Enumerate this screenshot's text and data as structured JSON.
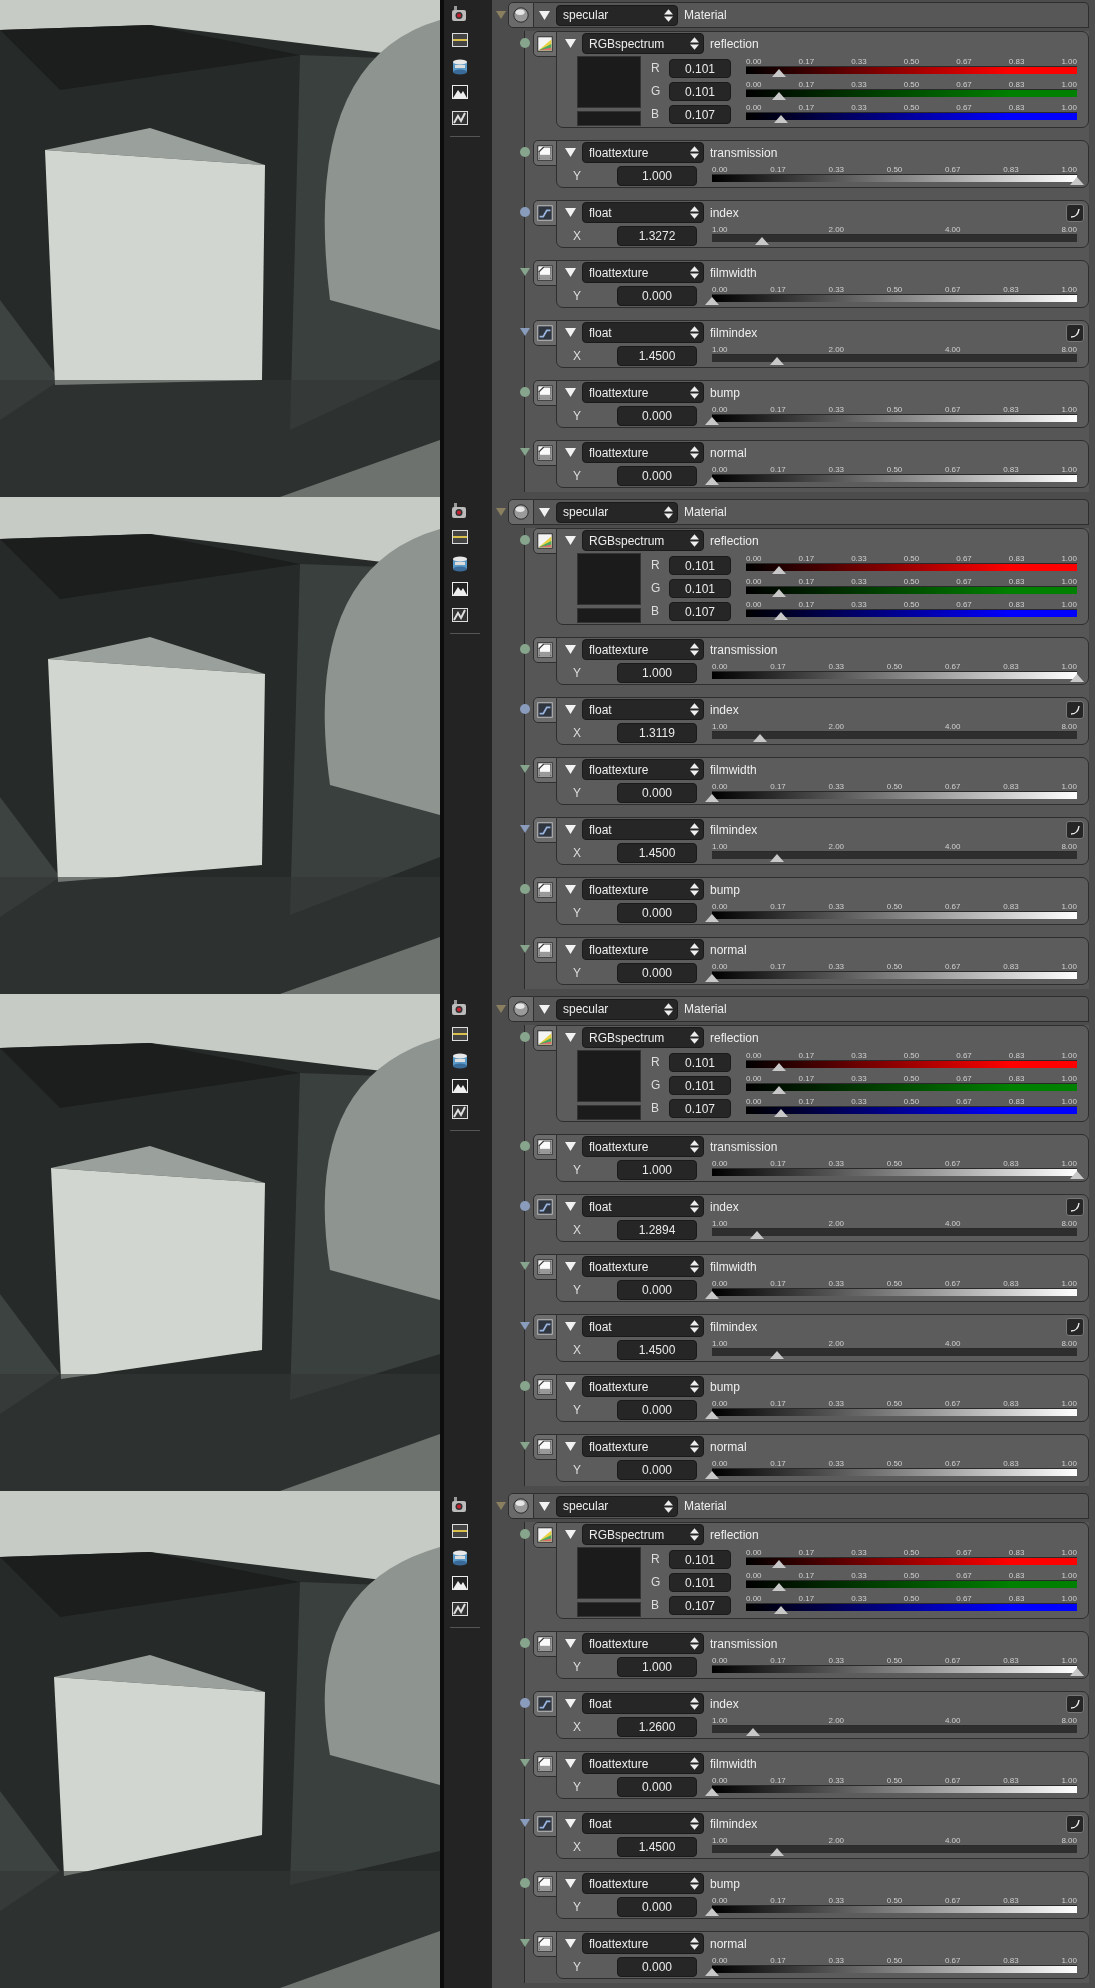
{
  "panels": [
    {
      "material": {
        "arrow_connector": true,
        "type": "specular",
        "label": "Material"
      },
      "params": [
        {
          "kind": "rgb",
          "arrow_connector": false,
          "type": "RGBspectrum",
          "name": "reflection",
          "channels": [
            {
              "axis": "R",
              "value": "0.101",
              "level": 0.101,
              "color": "#ff0000",
              "ticks": [
                "0.00",
                "0.17",
                "0.33",
                "0.50",
                "0.67",
                "0.83",
                "1.00"
              ]
            },
            {
              "axis": "G",
              "value": "0.101",
              "level": 0.101,
              "color": "#008000",
              "ticks": [
                "0.00",
                "0.17",
                "0.33",
                "0.50",
                "0.67",
                "0.83",
                "1.00"
              ]
            },
            {
              "axis": "B",
              "value": "0.107",
              "level": 0.107,
              "color": "#0000ff",
              "ticks": [
                "0.00",
                "0.17",
                "0.33",
                "0.50",
                "0.67",
                "0.83",
                "1.00"
              ]
            }
          ]
        },
        {
          "kind": "texture",
          "arrow_connector": false,
          "type": "floattexture",
          "name": "transmission",
          "axis": "Y",
          "value": "1.000",
          "level": 1,
          "ticks": [
            "0.00",
            "0.17",
            "0.33",
            "0.50",
            "0.67",
            "0.83",
            "1.00"
          ]
        },
        {
          "kind": "float",
          "arrow_connector": false,
          "type": "float",
          "name": "index",
          "axis": "X",
          "value": "1.3272",
          "level": 0.136,
          "ticks": [
            "1.00",
            "2.00",
            "4.00",
            "8.00"
          ]
        },
        {
          "kind": "texture",
          "arrow_connector": true,
          "type": "floattexture",
          "name": "filmwidth",
          "axis": "Y",
          "value": "0.000",
          "level": 0,
          "ticks": [
            "0.00",
            "0.17",
            "0.33",
            "0.50",
            "0.67",
            "0.83",
            "1.00"
          ]
        },
        {
          "kind": "float",
          "arrow_connector": true,
          "type": "float",
          "name": "filmindex",
          "axis": "X",
          "value": "1.4500",
          "level": 0.179,
          "ticks": [
            "1.00",
            "2.00",
            "4.00",
            "8.00"
          ]
        },
        {
          "kind": "texture",
          "arrow_connector": false,
          "type": "floattexture",
          "name": "bump",
          "axis": "Y",
          "value": "0.000",
          "level": 0,
          "ticks": [
            "0.00",
            "0.17",
            "0.33",
            "0.50",
            "0.67",
            "0.83",
            "1.00"
          ]
        },
        {
          "kind": "texture",
          "arrow_connector": true,
          "type": "floattexture",
          "name": "normal",
          "axis": "Y",
          "value": "0.000",
          "level": 0,
          "ticks": [
            "0.00",
            "0.17",
            "0.33",
            "0.50",
            "0.67",
            "0.83",
            "1.00"
          ]
        }
      ]
    },
    {
      "material": {
        "arrow_connector": true,
        "type": "specular",
        "label": "Material"
      },
      "params": [
        {
          "kind": "rgb",
          "arrow_connector": false,
          "type": "RGBspectrum",
          "name": "reflection",
          "channels": [
            {
              "axis": "R",
              "value": "0.101",
              "level": 0.101,
              "color": "#ff0000",
              "ticks": [
                "0.00",
                "0.17",
                "0.33",
                "0.50",
                "0.67",
                "0.83",
                "1.00"
              ]
            },
            {
              "axis": "G",
              "value": "0.101",
              "level": 0.101,
              "color": "#008000",
              "ticks": [
                "0.00",
                "0.17",
                "0.33",
                "0.50",
                "0.67",
                "0.83",
                "1.00"
              ]
            },
            {
              "axis": "B",
              "value": "0.107",
              "level": 0.107,
              "color": "#0000ff",
              "ticks": [
                "0.00",
                "0.17",
                "0.33",
                "0.50",
                "0.67",
                "0.83",
                "1.00"
              ]
            }
          ]
        },
        {
          "kind": "texture",
          "arrow_connector": false,
          "type": "floattexture",
          "name": "transmission",
          "axis": "Y",
          "value": "1.000",
          "level": 1,
          "ticks": [
            "0.00",
            "0.17",
            "0.33",
            "0.50",
            "0.67",
            "0.83",
            "1.00"
          ]
        },
        {
          "kind": "float",
          "arrow_connector": false,
          "type": "float",
          "name": "index",
          "axis": "X",
          "value": "1.3119",
          "level": 0.131,
          "ticks": [
            "1.00",
            "2.00",
            "4.00",
            "8.00"
          ]
        },
        {
          "kind": "texture",
          "arrow_connector": true,
          "type": "floattexture",
          "name": "filmwidth",
          "axis": "Y",
          "value": "0.000",
          "level": 0,
          "ticks": [
            "0.00",
            "0.17",
            "0.33",
            "0.50",
            "0.67",
            "0.83",
            "1.00"
          ]
        },
        {
          "kind": "float",
          "arrow_connector": true,
          "type": "float",
          "name": "filmindex",
          "axis": "X",
          "value": "1.4500",
          "level": 0.179,
          "ticks": [
            "1.00",
            "2.00",
            "4.00",
            "8.00"
          ]
        },
        {
          "kind": "texture",
          "arrow_connector": false,
          "type": "floattexture",
          "name": "bump",
          "axis": "Y",
          "value": "0.000",
          "level": 0,
          "ticks": [
            "0.00",
            "0.17",
            "0.33",
            "0.50",
            "0.67",
            "0.83",
            "1.00"
          ]
        },
        {
          "kind": "texture",
          "arrow_connector": true,
          "type": "floattexture",
          "name": "normal",
          "axis": "Y",
          "value": "0.000",
          "level": 0,
          "ticks": [
            "0.00",
            "0.17",
            "0.33",
            "0.50",
            "0.67",
            "0.83",
            "1.00"
          ]
        }
      ]
    },
    {
      "material": {
        "arrow_connector": true,
        "type": "specular",
        "label": "Material"
      },
      "params": [
        {
          "kind": "rgb",
          "arrow_connector": false,
          "type": "RGBspectrum",
          "name": "reflection",
          "channels": [
            {
              "axis": "R",
              "value": "0.101",
              "level": 0.101,
              "color": "#ff0000",
              "ticks": [
                "0.00",
                "0.17",
                "0.33",
                "0.50",
                "0.67",
                "0.83",
                "1.00"
              ]
            },
            {
              "axis": "G",
              "value": "0.101",
              "level": 0.101,
              "color": "#008000",
              "ticks": [
                "0.00",
                "0.17",
                "0.33",
                "0.50",
                "0.67",
                "0.83",
                "1.00"
              ]
            },
            {
              "axis": "B",
              "value": "0.107",
              "level": 0.107,
              "color": "#0000ff",
              "ticks": [
                "0.00",
                "0.17",
                "0.33",
                "0.50",
                "0.67",
                "0.83",
                "1.00"
              ]
            }
          ]
        },
        {
          "kind": "texture",
          "arrow_connector": false,
          "type": "floattexture",
          "name": "transmission",
          "axis": "Y",
          "value": "1.000",
          "level": 1,
          "ticks": [
            "0.00",
            "0.17",
            "0.33",
            "0.50",
            "0.67",
            "0.83",
            "1.00"
          ]
        },
        {
          "kind": "float",
          "arrow_connector": false,
          "type": "float",
          "name": "index",
          "axis": "X",
          "value": "1.2894",
          "level": 0.122,
          "ticks": [
            "1.00",
            "2.00",
            "4.00",
            "8.00"
          ]
        },
        {
          "kind": "texture",
          "arrow_connector": true,
          "type": "floattexture",
          "name": "filmwidth",
          "axis": "Y",
          "value": "0.000",
          "level": 0,
          "ticks": [
            "0.00",
            "0.17",
            "0.33",
            "0.50",
            "0.67",
            "0.83",
            "1.00"
          ]
        },
        {
          "kind": "float",
          "arrow_connector": true,
          "type": "float",
          "name": "filmindex",
          "axis": "X",
          "value": "1.4500",
          "level": 0.179,
          "ticks": [
            "1.00",
            "2.00",
            "4.00",
            "8.00"
          ]
        },
        {
          "kind": "texture",
          "arrow_connector": false,
          "type": "floattexture",
          "name": "bump",
          "axis": "Y",
          "value": "0.000",
          "level": 0,
          "ticks": [
            "0.00",
            "0.17",
            "0.33",
            "0.50",
            "0.67",
            "0.83",
            "1.00"
          ]
        },
        {
          "kind": "texture",
          "arrow_connector": true,
          "type": "floattexture",
          "name": "normal",
          "axis": "Y",
          "value": "0.000",
          "level": 0,
          "ticks": [
            "0.00",
            "0.17",
            "0.33",
            "0.50",
            "0.67",
            "0.83",
            "1.00"
          ]
        }
      ]
    },
    {
      "material": {
        "arrow_connector": true,
        "type": "specular",
        "label": "Material"
      },
      "params": [
        {
          "kind": "rgb",
          "arrow_connector": false,
          "type": "RGBspectrum",
          "name": "reflection",
          "channels": [
            {
              "axis": "R",
              "value": "0.101",
              "level": 0.101,
              "color": "#ff0000",
              "ticks": [
                "0.00",
                "0.17",
                "0.33",
                "0.50",
                "0.67",
                "0.83",
                "1.00"
              ]
            },
            {
              "axis": "G",
              "value": "0.101",
              "level": 0.101,
              "color": "#008000",
              "ticks": [
                "0.00",
                "0.17",
                "0.33",
                "0.50",
                "0.67",
                "0.83",
                "1.00"
              ]
            },
            {
              "axis": "B",
              "value": "0.107",
              "level": 0.107,
              "color": "#0000ff",
              "ticks": [
                "0.00",
                "0.17",
                "0.33",
                "0.50",
                "0.67",
                "0.83",
                "1.00"
              ]
            }
          ]
        },
        {
          "kind": "texture",
          "arrow_connector": false,
          "type": "floattexture",
          "name": "transmission",
          "axis": "Y",
          "value": "1.000",
          "level": 1,
          "ticks": [
            "0.00",
            "0.17",
            "0.33",
            "0.50",
            "0.67",
            "0.83",
            "1.00"
          ]
        },
        {
          "kind": "float",
          "arrow_connector": false,
          "type": "float",
          "name": "index",
          "axis": "X",
          "value": "1.2600",
          "level": 0.111,
          "ticks": [
            "1.00",
            "2.00",
            "4.00",
            "8.00"
          ]
        },
        {
          "kind": "texture",
          "arrow_connector": true,
          "type": "floattexture",
          "name": "filmwidth",
          "axis": "Y",
          "value": "0.000",
          "level": 0,
          "ticks": [
            "0.00",
            "0.17",
            "0.33",
            "0.50",
            "0.67",
            "0.83",
            "1.00"
          ]
        },
        {
          "kind": "float",
          "arrow_connector": true,
          "type": "float",
          "name": "filmindex",
          "axis": "X",
          "value": "1.4500",
          "level": 0.179,
          "ticks": [
            "1.00",
            "2.00",
            "4.00",
            "8.00"
          ]
        },
        {
          "kind": "texture",
          "arrow_connector": false,
          "type": "floattexture",
          "name": "bump",
          "axis": "Y",
          "value": "0.000",
          "level": 0,
          "ticks": [
            "0.00",
            "0.17",
            "0.33",
            "0.50",
            "0.67",
            "0.83",
            "1.00"
          ]
        },
        {
          "kind": "texture",
          "arrow_connector": true,
          "type": "floattexture",
          "name": "normal",
          "axis": "Y",
          "value": "0.000",
          "level": 0,
          "ticks": [
            "0.00",
            "0.17",
            "0.33",
            "0.50",
            "0.67",
            "0.83",
            "1.00"
          ]
        }
      ]
    }
  ]
}
